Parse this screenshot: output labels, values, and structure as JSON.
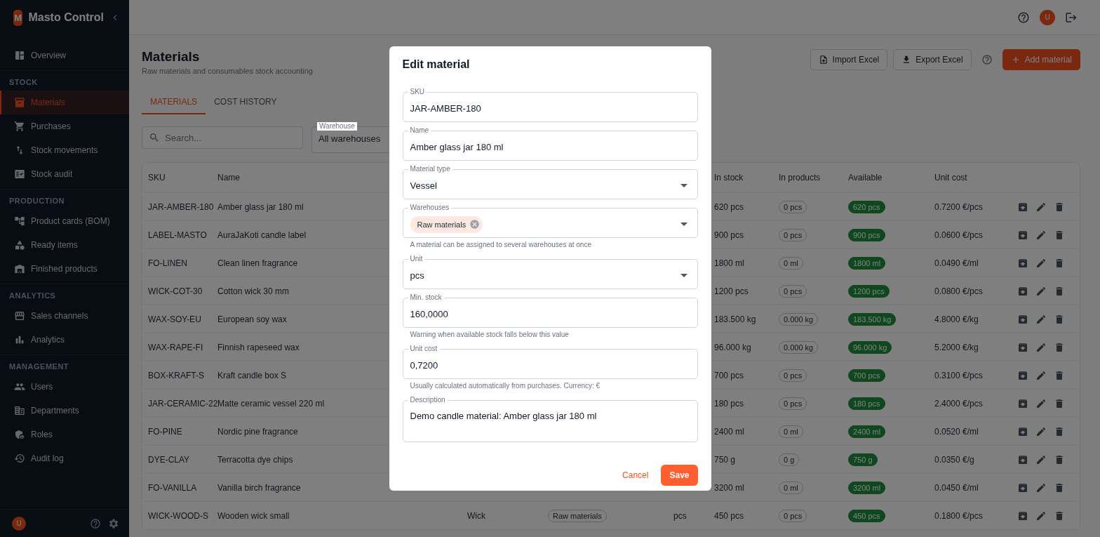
{
  "app": {
    "logo_letter": "M",
    "name": "Masto Control"
  },
  "sidebar": {
    "top_items": [
      {
        "label": "Overview",
        "selected": false
      }
    ],
    "sections": [
      {
        "heading": "STOCK",
        "items": [
          {
            "label": "Materials",
            "selected": true
          },
          {
            "label": "Purchases",
            "selected": false
          },
          {
            "label": "Stock movements",
            "selected": false
          },
          {
            "label": "Stock audit",
            "selected": false
          }
        ]
      },
      {
        "heading": "PRODUCTION",
        "items": [
          {
            "label": "Product cards (BOM)",
            "selected": false
          },
          {
            "label": "Ready items",
            "selected": false
          },
          {
            "label": "Finished products",
            "selected": false
          }
        ]
      },
      {
        "heading": "ANALYTICS",
        "items": [
          {
            "label": "Sales channels",
            "selected": false
          },
          {
            "label": "Analytics",
            "selected": false
          }
        ]
      },
      {
        "heading": "MANAGEMENT",
        "items": [
          {
            "label": "Users",
            "selected": false
          },
          {
            "label": "Departments",
            "selected": false
          },
          {
            "label": "Roles",
            "selected": false
          },
          {
            "label": "Audit log",
            "selected": false
          }
        ]
      }
    ],
    "user_avatar": "U"
  },
  "topbar": {
    "user_avatar": "U"
  },
  "page": {
    "title": "Materials",
    "subtitle": "Raw materials and consumables stock accounting",
    "actions": [
      {
        "kind": "import",
        "label": "Import Excel"
      },
      {
        "kind": "export",
        "label": "Export Excel"
      },
      {
        "kind": "help"
      },
      {
        "kind": "add",
        "label": "Add material"
      }
    ],
    "tabs": [
      {
        "label": "MATERIALS",
        "selected": true
      },
      {
        "label": "COST HISTORY",
        "selected": false
      }
    ],
    "search": {
      "placeholder": "Search..."
    },
    "warehouse_filter": {
      "label": "Warehouse",
      "value": "All warehouses"
    }
  },
  "table": {
    "columns": [
      "SKU",
      "Name",
      "In stock",
      "In products",
      "Available",
      "Unit cost"
    ],
    "rows": [
      {
        "sku": "JAR-AMBER-180",
        "name": "Amber glass jar 180 ml",
        "in_stock": "620 pcs",
        "in_products": "0 pcs",
        "available": "620 pcs",
        "unit_cost": "0.7200 €/pcs"
      },
      {
        "sku": "LABEL-MASTO",
        "name": "AuraJaKoti candle label",
        "in_stock": "900 pcs",
        "in_products": "0 pcs",
        "available": "900 pcs",
        "unit_cost": "0.0600 €/pcs"
      },
      {
        "sku": "FO-LINEN",
        "name": "Clean linen fragrance",
        "in_stock": "1800 ml",
        "in_products": "0 ml",
        "available": "1800 ml",
        "unit_cost": "0.0490 €/ml"
      },
      {
        "sku": "WICK-COT-30",
        "name": "Cotton wick 30 mm",
        "in_stock": "1200 pcs",
        "in_products": "0 pcs",
        "available": "1200 pcs",
        "unit_cost": "0.0800 €/pcs"
      },
      {
        "sku": "WAX-SOY-EU",
        "name": "European soy wax",
        "in_stock": "183.500 kg",
        "in_products": "0.000 kg",
        "available": "183.500 kg",
        "unit_cost": "4.8000 €/kg"
      },
      {
        "sku": "WAX-RAPE-FI",
        "name": "Finnish rapeseed wax",
        "in_stock": "96.000 kg",
        "in_products": "0.000 kg",
        "available": "96.000 kg",
        "unit_cost": "5.2000 €/kg"
      },
      {
        "sku": "BOX-KRAFT-S",
        "name": "Kraft candle box S",
        "in_stock": "700 pcs",
        "in_products": "0 pcs",
        "available": "700 pcs",
        "unit_cost": "0.3100 €/pcs"
      },
      {
        "sku": "JAR-CERAMIC-22",
        "name": "Matte ceramic vessel 220 ml",
        "in_stock": "180 pcs",
        "in_products": "0 pcs",
        "available": "180 pcs",
        "unit_cost": "2.4000 €/pcs"
      },
      {
        "sku": "FO-PINE",
        "name": "Nordic pine fragrance",
        "in_stock": "2400 ml",
        "in_products": "0 ml",
        "available": "2400 ml",
        "unit_cost": "0.0520 €/ml"
      },
      {
        "sku": "DYE-CLAY",
        "name": "Terracotta dye chips",
        "in_stock": "750 g",
        "in_products": "0 g",
        "available": "750 g",
        "unit_cost": "0.0350 €/g"
      },
      {
        "sku": "FO-VANILLA",
        "name": "Vanilla birch fragrance",
        "in_stock": "3200 ml",
        "in_products": "0 ml",
        "available": "3200 ml",
        "unit_cost": "0.0450 €/ml"
      },
      {
        "sku": "WICK-WOOD-S",
        "name": "Wooden wick small",
        "type": "Wick",
        "warehouse": "Raw materials",
        "unit": "pcs",
        "in_stock": "450 pcs",
        "in_products": "0 pcs",
        "available": "450 pcs",
        "unit_cost": "0.1800 €/pcs"
      }
    ]
  },
  "dialog": {
    "title": "Edit material",
    "fields": [
      {
        "kind": "text",
        "label": "SKU",
        "value": "JAR-AMBER-180"
      },
      {
        "kind": "text",
        "label": "Name",
        "value": "Amber glass jar 180 ml"
      },
      {
        "kind": "select",
        "label": "Material type",
        "value": "Vessel"
      },
      {
        "kind": "chips",
        "label": "Warehouses",
        "chips": [
          "Raw materials"
        ],
        "helper": "A material can be assigned to several warehouses at once"
      },
      {
        "kind": "select",
        "label": "Unit",
        "value": "pcs"
      },
      {
        "kind": "text",
        "label": "Min. stock",
        "value": "160,0000",
        "helper": "Warning when available stock falls below this value"
      },
      {
        "kind": "text",
        "label": "Unit cost",
        "value": "0,7200",
        "helper": "Usually calculated automatically from purchases. Currency: €"
      },
      {
        "kind": "textarea",
        "label": "Description",
        "value": "Demo candle material: Amber glass jar 180 ml"
      }
    ],
    "cancel": "Cancel",
    "save": "Save"
  }
}
